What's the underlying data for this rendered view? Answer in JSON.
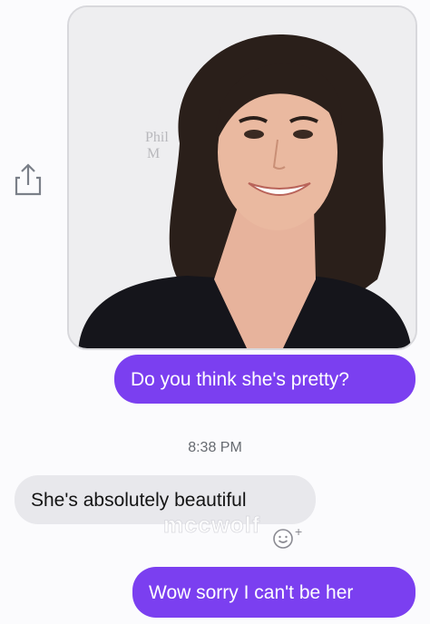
{
  "colors": {
    "sent_bubble": "#7b3ff0",
    "received_bubble": "#e8e8ec",
    "background": "#fbfbfd"
  },
  "photo": {
    "backdrop_text_line1": "Phil",
    "backdrop_text_line2": "M"
  },
  "messages": [
    {
      "direction": "sent",
      "text": "Do you think she's pretty?"
    },
    {
      "direction": "received",
      "text": "She's absolutely beautiful"
    },
    {
      "direction": "sent",
      "text": "Wow sorry I can't be her"
    }
  ],
  "timestamp": "8:38 PM",
  "watermark": "mccwolf",
  "reaction": {
    "plus": "+"
  },
  "icons": {
    "share": "share-icon",
    "react": "smiley-icon"
  }
}
